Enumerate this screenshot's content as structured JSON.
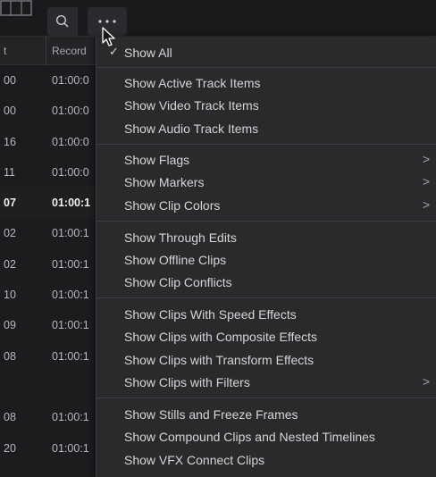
{
  "toolbar": {
    "search_icon": "search-icon",
    "more_icon": "more-options-icon",
    "columns_icon": "columns-icon"
  },
  "header": {
    "col_a": "t",
    "col_b": "Record"
  },
  "rows": [
    {
      "a": "00",
      "b": "01:00:0"
    },
    {
      "a": "00",
      "b": "01:00:0"
    },
    {
      "a": "16",
      "b": "01:00:0"
    },
    {
      "a": "11",
      "b": "01:00:0"
    },
    {
      "a": "07",
      "b": "01:00:1"
    },
    {
      "a": "02",
      "b": "01:00:1"
    },
    {
      "a": "02",
      "b": "01:00:1"
    },
    {
      "a": "10",
      "b": "01:00:1"
    },
    {
      "a": "09",
      "b": "01:00:1"
    },
    {
      "a": "08",
      "b": "01:00:1"
    },
    {
      "a": "",
      "b": ""
    },
    {
      "a": "08",
      "b": "01:00:1"
    },
    {
      "a": "20",
      "b": "01:00:1"
    }
  ],
  "selected_row_index": 4,
  "menu": {
    "show_all": "Show All",
    "show_active": "Show Active Track Items",
    "show_video": "Show Video Track Items",
    "show_audio": "Show Audio Track Items",
    "show_flags": "Show Flags",
    "show_markers": "Show Markers",
    "show_clip_colors": "Show Clip Colors",
    "show_through_edits": "Show Through Edits",
    "show_offline": "Show Offline Clips",
    "show_conflicts": "Show Clip Conflicts",
    "show_speed": "Show Clips With Speed Effects",
    "show_composite": "Show Clips with Composite Effects",
    "show_transform": "Show Clips with Transform Effects",
    "show_filters": "Show Clips with Filters",
    "show_stills": "Show Stills and Freeze Frames",
    "show_compound": "Show Compound Clips and Nested Timelines",
    "show_vfx": "Show VFX Connect Clips",
    "checkmark": "✓",
    "chevron": ">"
  }
}
